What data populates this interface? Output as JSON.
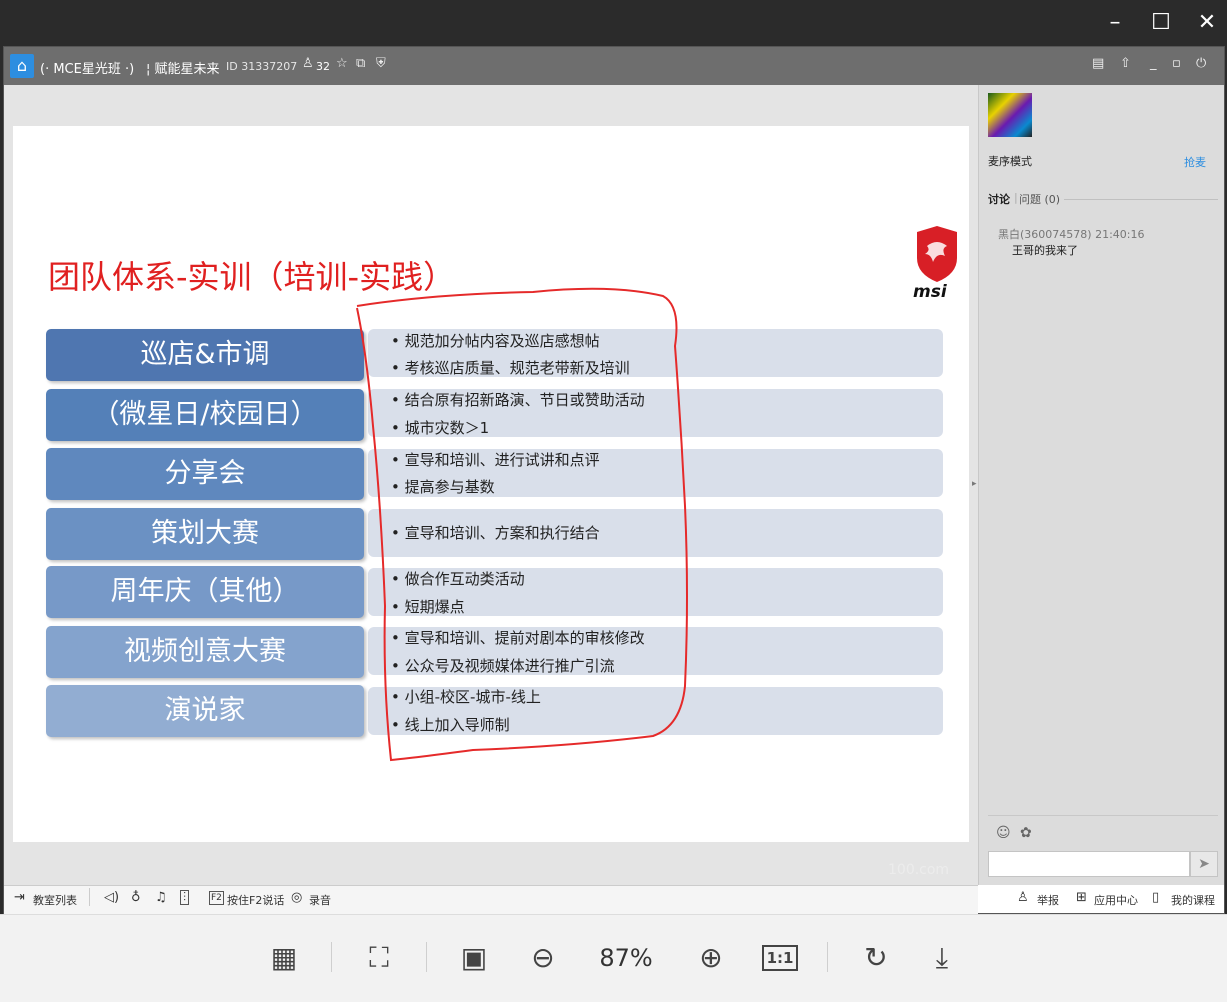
{
  "viewer": {
    "window_controls": {
      "minimize": "–",
      "maximize": "☐",
      "close": "✕"
    },
    "toolbar": {
      "layout_icon": "layout-icon",
      "fit_icon": "exit-fullscreen-icon",
      "fullscreen_icon": "fullscreen-icon",
      "zoom_out_icon": "zoom-out-icon",
      "zoom_level": "87%",
      "zoom_in_icon": "zoom-in-icon",
      "actual_size_label": "1:1",
      "rotate_icon": "rotate-icon",
      "download_icon": "download-icon"
    }
  },
  "app": {
    "header": {
      "room_name": "(· MCE星光班 ·)",
      "group_name": "¦ 赋能星未来",
      "room_id": "ID 31337207",
      "user_count": "32"
    },
    "slide": {
      "title": "团队体系-实训（培训-实践）",
      "logo_text": "msi",
      "watermark": "100.com",
      "rows": [
        {
          "label": "巡店&市调",
          "color": "#4f76b0",
          "bullets": [
            "规范加分帖内容及巡店感想帖",
            "考核巡店质量、规范老带新及培训"
          ]
        },
        {
          "label": "（微星日/校园日）",
          "color": "#5480b8",
          "bullets": [
            "结合原有招新路演、节日或赞助活动",
            "城市灾数＞1"
          ]
        },
        {
          "label": "分享会",
          "color": "#5f88be",
          "bullets": [
            "宣导和培训、进行试讲和点评",
            "提高参与基数"
          ]
        },
        {
          "label": "策划大赛",
          "color": "#6b91c3",
          "bullets": [
            "宣导和培训、方案和执行结合"
          ]
        },
        {
          "label": "周年庆（其他）",
          "color": "#7799c8",
          "bullets": [
            "做合作互动类活动",
            "短期爆点"
          ]
        },
        {
          "label": "视频创意大赛",
          "color": "#84a3cd",
          "bullets": [
            "宣导和培训、提前对剧本的审核修改",
            "公众号及视频媒体进行推广引流"
          ]
        },
        {
          "label": "演说家",
          "color": "#92add2",
          "bullets": [
            "小组-校区-城市-线上",
            "线上加入导师制"
          ]
        }
      ]
    },
    "bottom_bar": {
      "classroom_list": "教室列表",
      "hold_to_talk": "按住F2说话",
      "record": "录音",
      "report": "举报",
      "app_center": "应用中心",
      "my_courses": "我的课程"
    },
    "side_panel": {
      "mic_mode": "麦序模式",
      "grab_mic": "抢麦",
      "tab_discuss": "讨论",
      "tab_question": "问题 (0)",
      "message": {
        "meta": "黑白(360074578) 21:40:16",
        "text": "王哥的我来了"
      }
    }
  }
}
